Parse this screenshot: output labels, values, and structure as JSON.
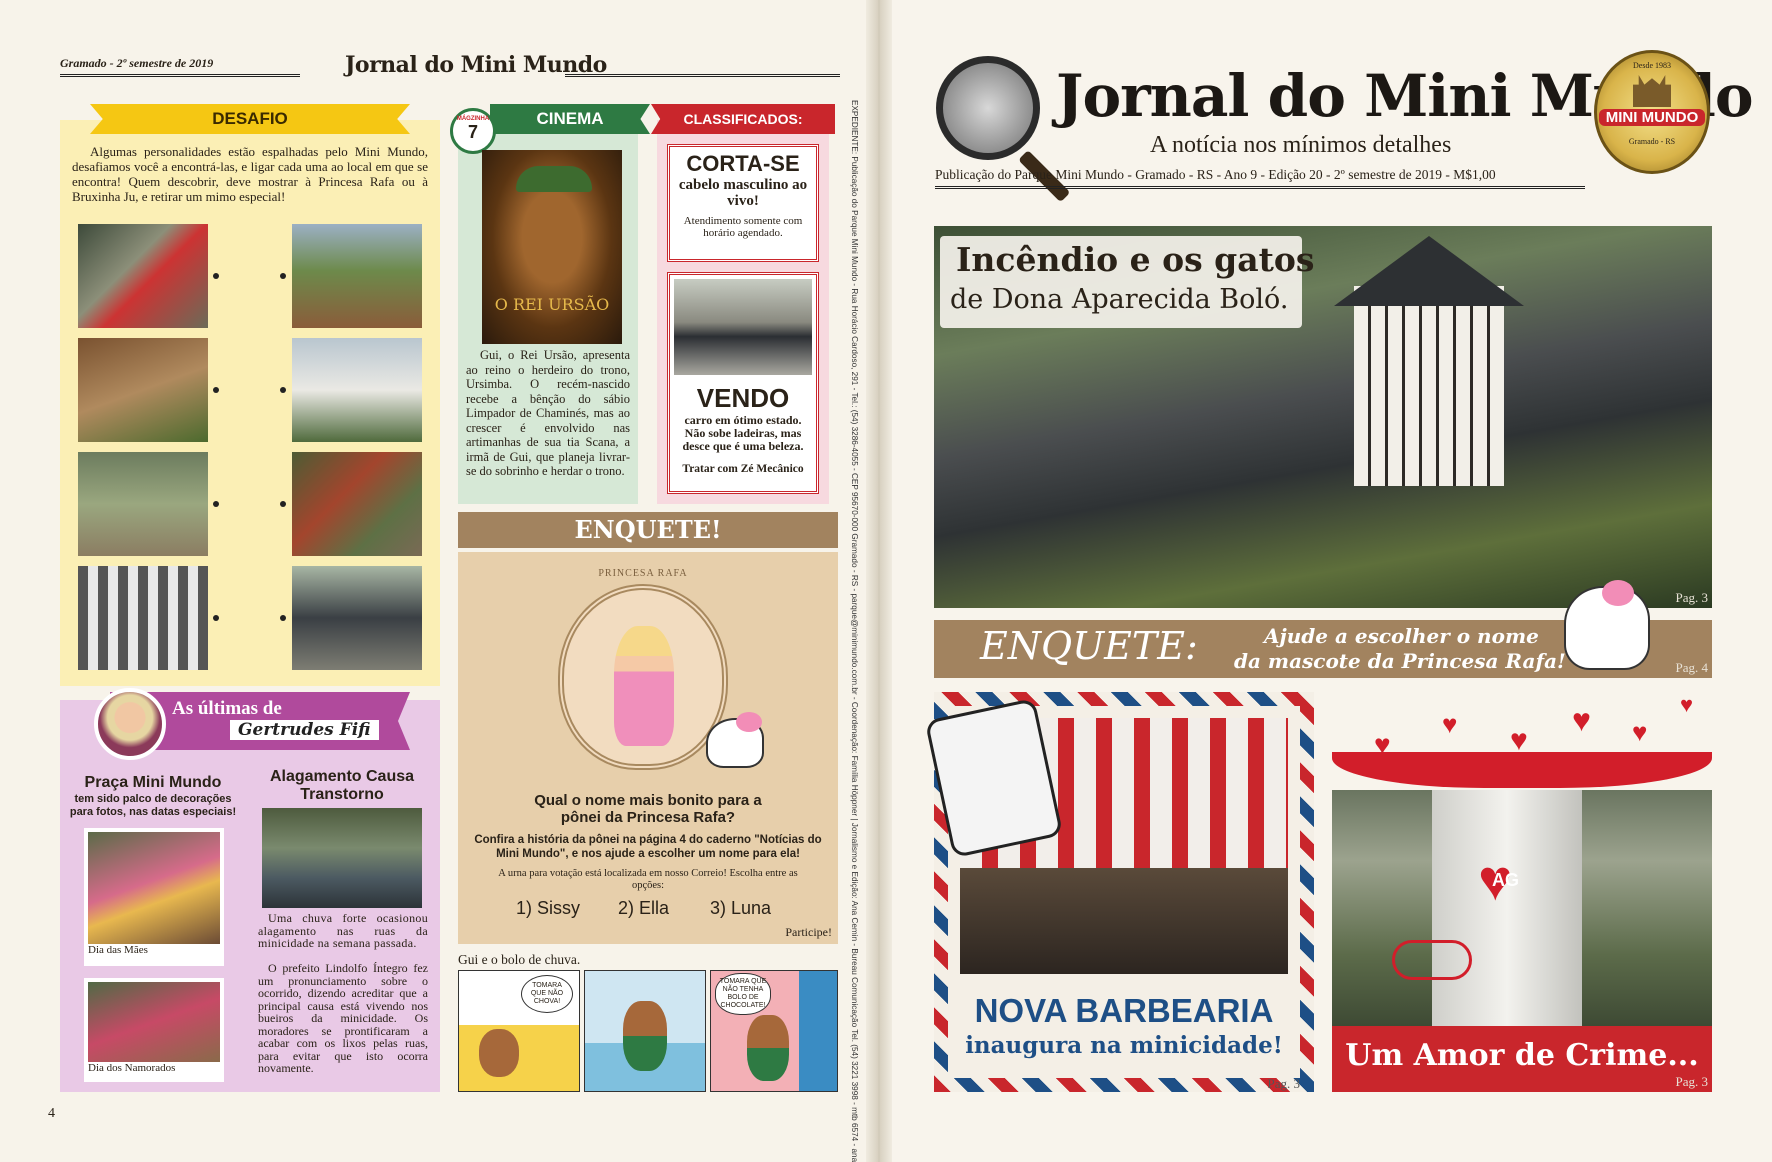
{
  "left": {
    "edition": "Gramado - 2º semestre de 2019",
    "brand": "Jornal do Mini Mundo",
    "page_number": "4",
    "desafio": {
      "title": "DESAFIO",
      "text": "Algumas personalidades estão espalhadas pelo Mini Mundo, desafiamos você a encontrá-las, e ligar cada uma ao local em que se encontra! Quem descobrir, deve mostrar à Princesa Rafa ou à Bruxinha Ju, e retirar um mimo especial!"
    },
    "cinema": {
      "title": "CINEMA",
      "badge_label": "MÁGZINHA",
      "badge_number": "7",
      "poster_title": "O REI URSÃO",
      "text": "Gui, o Rei Ursão, apresenta ao reino o herdeiro do trono, Ursimba. O recém-nascido recebe a bênção do sábio Limpador de Chaminés, mas ao crescer é envolvido nas artimanhas de sua tia Scana, a irmã de Gui, que planeja livrar-se do sobrinho e herdar o trono."
    },
    "classificados": {
      "title": "CLASSIFICADOS:",
      "ad1_headline": "CORTA-SE",
      "ad1_sub": "cabelo masculino ao vivo!",
      "ad1_note": "Atendimento somente com horário agendado.",
      "ad2_headline": "VENDO",
      "ad2_sub": "carro em ótimo estado. Não sobe ladeiras, mas desce que é uma beleza.",
      "ad2_contact": "Tratar com Zé Mecânico"
    },
    "enquete": {
      "title": "ENQUETE!",
      "frame_label": "PRINCESA RAFA",
      "question": "Qual o nome mais bonito para a pônei da Princesa Rafa?",
      "instructions": "Confira a história da pônei na página 4 do caderno \"Notícias do Mini Mundo\", e nos ajude a escolher um nome para ela!",
      "urna": "A urna para votação está localizada em nosso Correio! Escolha entre as opções:",
      "option1": "1) Sissy",
      "option2": "2) Ella",
      "option3": "3) Luna",
      "cta": "Participe!"
    },
    "gertrudes": {
      "title": "As últimas de",
      "name": "Gertrudes Fifi",
      "col1_head": "Praça Mini Mundo",
      "col1_sub": "tem sido palco de decorações para fotos, nas datas especiais!",
      "caption1": "Dia das Mães",
      "caption2": "Dia dos Namorados",
      "col2_head": "Alagamento Causa Transtorno",
      "col2_text1": "Uma chuva forte ocasionou alagamento nas ruas da minicidade na semana passada.",
      "col2_text2": "O prefeito Lindolfo Íntegro fez um pronunciamento sobre o ocorrido, dizendo acreditar que a principal causa está vivendo nos bueiros da minicidade. Os moradores se prontificaram a acabar com os lixos pelas ruas, para evitar que isto ocorra novamente."
    },
    "comic": {
      "title": "Gui e o bolo de chuva.",
      "bubble1": "TOMARA QUE NÃO CHOVA!",
      "bubble2": "TOMARA QUE NÃO TENHA BOLO DE CHOCOLATE!"
    },
    "credits": "EXPEDIENTE: Publicação do Parque Mini Mundo - Rua Horácio Cardoso, 291 - Tel.: (54) 3286-4055 - CEP 95670-000 Gramado - RS - parque@minimundo.com.br - Coordenação: Família Höppner | Jornalismo e Edição: Ana Cemin - Bureau Comunicação Tel. (54) 3221 3998 - mtb 6574 - ana@bureaucom.com.br - Fotografias: Adriana, Alexandre, Bárbara, Charlize, Glauber, Nelson - Produção: Turma do Mini Mundo - Cenas: Charlize e Junelly - Design Gráfico e Diagramação: Tecnart Design - Impressão: Gráfica Centhury - É permitida a reprodução, desde que citada a fonte. | Visite nosso site: www.minimundo.com.br"
  },
  "right": {
    "masthead": "Jornal do Mini Mundo",
    "tagline": "A notícia nos mínimos detalhes",
    "pubinfo": "Publicação do Parque Mini Mundo - Gramado - RS - Ano 9 - Edição 20 - 2º semestre de 2019 - M$1,00",
    "logo_top": "Desde 1983",
    "logo_text": "MINI MUNDO",
    "logo_bottom": "Gramado - RS",
    "lead_title1": "Incêndio e os gatos",
    "lead_title2": "de Dona Aparecida Boló.",
    "lead_pag": "Pag. 3",
    "enquete_label": "ENQUETE:",
    "enquete_text1": "Ajude a escolher o nome",
    "enquete_text2": "da mascote da Princesa Rafa!",
    "enquete_pag": "Pag. 4",
    "barbearia_title": "NOVA BARBEARIA",
    "barbearia_sub": "inaugura na minicidade!",
    "barbearia_pag": "Pag. 3",
    "crime_tag": "AG",
    "crime_title": "Um Amor de Crime...",
    "crime_pag": "Pag. 3"
  },
  "colors": {
    "accent_red": "#c9262c",
    "accent_green": "#2e7a43",
    "accent_yellow": "#f5c713",
    "accent_purple": "#b04a9c",
    "enquete_brown": "#a2835f",
    "barbearia_blue": "#1e4f86"
  }
}
